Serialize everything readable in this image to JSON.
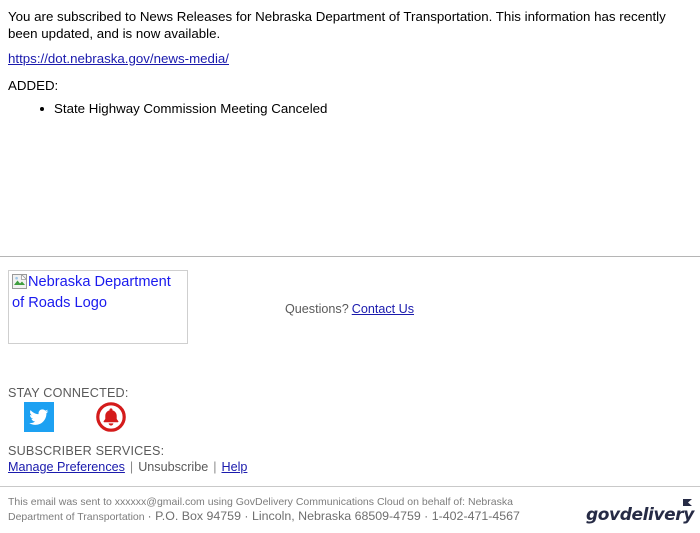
{
  "message": {
    "intro": "You are subscribed to News Releases for Nebraska Department of Transportation. This information has recently been updated, and is now available.",
    "url_text": "https://dot.nebraska.gov/news-media/",
    "added_label": "ADDED:",
    "added_items": [
      "State Highway Commission Meeting Canceled"
    ]
  },
  "footer": {
    "logo_alt": "Nebraska Department of Roads Logo",
    "questions_label": "Questions?",
    "contact_link": "Contact Us",
    "stay_connected_label": "STAY CONNECTED:",
    "social": [
      {
        "name": "twitter",
        "label": "Twitter"
      },
      {
        "name": "govdelivery-bell",
        "label": "GovDelivery Alerts"
      }
    ],
    "subscriber_services_label": "SUBSCRIBER SERVICES:",
    "links": {
      "manage": "Manage Preferences",
      "unsubscribe": "Unsubscribe",
      "help": "Help",
      "separator": "|"
    }
  },
  "legal": {
    "line1": "This email was sent to xxxxxx@gmail.com using GovDelivery Communications Cloud on behalf of: Nebraska Department of",
    "line2_small": "Transportation",
    "line2_big": "· P.O. Box 94759 · Lincoln, Nebraska 68509-4759 · 1-402-471-4567",
    "brand_wordmark": "govdelivery"
  },
  "colors": {
    "link": "#1a1aad",
    "muted_text": "#5a5a5a",
    "twitter_blue": "#1da1f2",
    "bell_red": "#d41b1b",
    "govdelivery_navy": "#262b45",
    "divider": "#b5b5b5"
  }
}
